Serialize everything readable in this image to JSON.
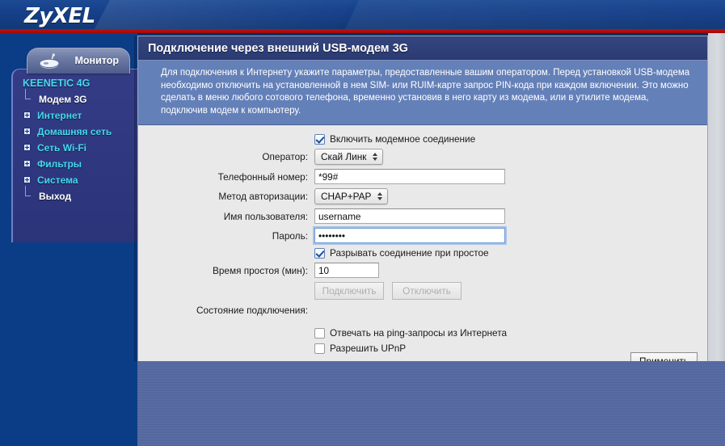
{
  "brand": {
    "logo": "ZyXEL"
  },
  "sidebar": {
    "tab_label": "Монитор",
    "tab_icon": "router-icon",
    "menu_title": "KEENETIC 4G",
    "items": [
      {
        "label": "Модем 3G",
        "type": "leaf",
        "active": true
      },
      {
        "label": "Интернет",
        "type": "parent",
        "active": false
      },
      {
        "label": "Домашняя сеть",
        "type": "parent",
        "active": false
      },
      {
        "label": "Сеть Wi-Fi",
        "type": "parent",
        "active": false
      },
      {
        "label": "Фильтры",
        "type": "parent",
        "active": false
      },
      {
        "label": "Система",
        "type": "parent",
        "active": false
      },
      {
        "label": "Выход",
        "type": "leaf",
        "active": false
      }
    ]
  },
  "panel": {
    "title": "Подключение через внешний USB-модем 3G",
    "description": "Для подключения к Интернету укажите параметры, предоставленные вашим оператором. Перед установкой USB-модема необходимо отключить на установленной в нем SIM- или RUIM-карте запрос PIN-кода при каждом включении. Это можно сделать в меню любого сотового телефона, временно установив в него карту из модема, или в утилите модема, подключив модем к компьютеру."
  },
  "form": {
    "enable_modem": {
      "label": "Включить модемное соединение",
      "checked": true
    },
    "operator": {
      "label": "Оператор:",
      "value": "Скай Линк"
    },
    "phone": {
      "label": "Телефонный номер:",
      "value": "*99#"
    },
    "auth": {
      "label": "Метод авторизации:",
      "value": "CHAP+PAP"
    },
    "username": {
      "label": "Имя пользователя:",
      "value": "username"
    },
    "password": {
      "label": "Пароль:",
      "value": "••••••••",
      "focused": true
    },
    "idle_disconnect": {
      "label": "Разрывать соединение при простое",
      "checked": true
    },
    "idle_time": {
      "label": "Время простоя (мин):",
      "value": "10"
    },
    "connect_button": {
      "label": "Подключить",
      "enabled": false
    },
    "disconnect_button": {
      "label": "Отключить",
      "enabled": false
    },
    "status": {
      "label": "Состояние подключения:",
      "value": ""
    },
    "ping_reply": {
      "label": "Отвечать на ping-запросы из Интернета",
      "checked": false
    },
    "upnp": {
      "label": "Разрешить UPnP",
      "checked": false
    },
    "apply_button": {
      "label": "Применить"
    }
  },
  "colors": {
    "brand_blue": "#16408a",
    "accent_red": "#c01010",
    "panel_title": "#2a3a72",
    "panel_desc": "#6480b8",
    "menu_cyan": "#45d8ee",
    "page_bg": "#0b3d86"
  }
}
